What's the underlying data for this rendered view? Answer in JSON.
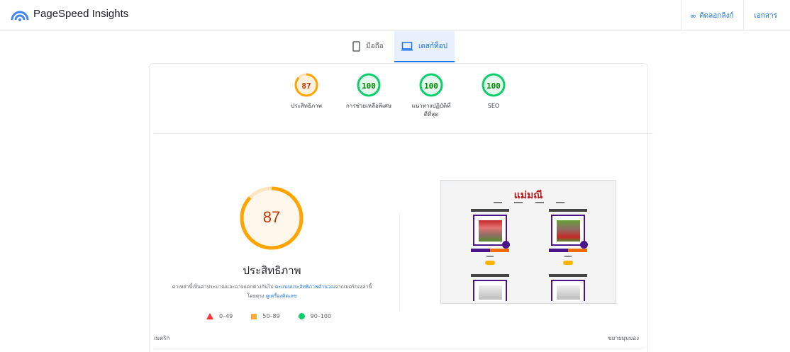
{
  "header": {
    "app_title": "PageSpeed Insights",
    "copy_link_label": "คัดลอกลิงก์",
    "docs_label": "เอกสาร"
  },
  "tabs": [
    {
      "label": "มือถือ",
      "icon": "smartphone-icon",
      "selected": false
    },
    {
      "label": "เดสก์ท็อป",
      "icon": "desktop-icon",
      "selected": true
    }
  ],
  "categories": [
    {
      "score": "87",
      "label": "ประสิทธิภาพ",
      "status_color": "#ffa400"
    },
    {
      "score": "100",
      "label": "การช่วยเหลือพิเศษ",
      "status_color": "#0cce6b"
    },
    {
      "score": "100",
      "label": "แนวทางปฏิบัติที่ดีที่สุด",
      "status_color": "#0cce6b"
    },
    {
      "score": "100",
      "label": "SEO",
      "status_color": "#0cce6b"
    }
  ],
  "performance": {
    "score": "87",
    "fraction": 0.87,
    "title": "ประสิทธิภาพ",
    "desc_part1": "ค่าเหล่านี้เป็นค่าประมาณและอาจแตกต่างกันไป ",
    "desc_link1": "คะแนนประสิทธิภาพคำนวณ",
    "desc_part2": "จากเมตริกเหล่านี้โดยตรง ",
    "desc_link2": "ดูเครื่องคิดเลข"
  },
  "legend": [
    {
      "range": "0–49",
      "shape": "triangle",
      "color": "#ff3333"
    },
    {
      "range": "50–89",
      "shape": "square",
      "color": "#ffaa33"
    },
    {
      "range": "90–100",
      "shape": "circle",
      "color": "#0cce6b"
    }
  ],
  "screenshot": {
    "shop_name": "แม่มณี"
  },
  "footer": {
    "metrics_label": "เมตริก",
    "expand_label": "ขยายมุมมอง"
  },
  "colors": {
    "accent": "#1a73e8",
    "average": "#ffa400",
    "pass": "#0cce6b"
  }
}
